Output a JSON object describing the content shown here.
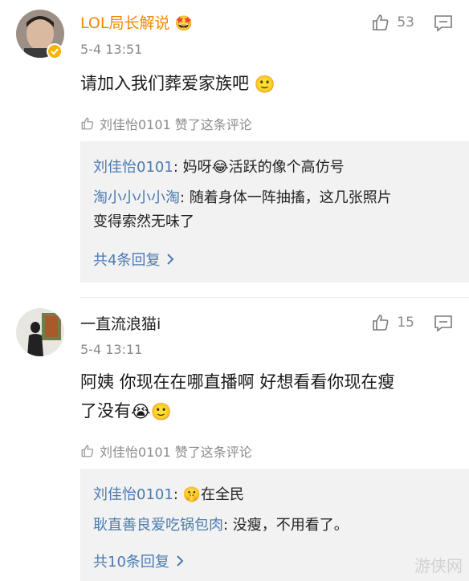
{
  "comments": [
    {
      "username": "LOL局长解说",
      "username_color": "#f08a00",
      "badge_emoji": "🤩",
      "timestamp": "5-4 13:51",
      "likes": "53",
      "text": "请加入我们葬爱家族吧",
      "text_emoji": "🙂",
      "liked_by": "刘佳怡0101 赞了这条评论",
      "replies": [
        {
          "name": "刘佳怡0101",
          "pre": ": 妈呀",
          "emoji": "😂",
          "post": "活跃的像个高仿号"
        },
        {
          "name": "淘小小小小淘",
          "text": ": 随着身体一阵抽搐，这几张照片",
          "text2": "变得索然无味了"
        }
      ],
      "more": "共4条回复"
    },
    {
      "username": "一直流浪猫i",
      "timestamp": "5-4 13:11",
      "likes": "15",
      "text_line1": "阿姨 你现在在哪直播啊 好想看看你现在瘦",
      "text_line2": "了没有",
      "text_emojis": [
        "😭",
        "🙂"
      ],
      "liked_by": "刘佳怡0101 赞了这条评论",
      "replies": [
        {
          "name": "刘佳怡0101",
          "pre": ": ",
          "emoji": "🤫",
          "post": "在全民"
        },
        {
          "name": "耿直善良爱吃锅包肉",
          "text": ": 没瘦，不用看了。"
        }
      ],
      "more": "共10条回复"
    }
  ],
  "icons": {
    "like": "thumbs-up-icon",
    "reply": "comment-icon",
    "liked_small": "thumbs-up-small-icon",
    "chevron": "chevron-right-icon"
  },
  "watermark": "游侠网"
}
